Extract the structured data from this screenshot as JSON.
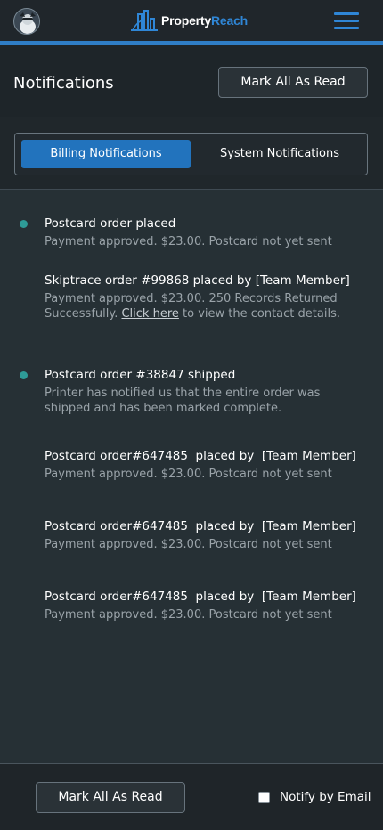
{
  "brand": {
    "name_part1": "Property",
    "name_part2": "Reach",
    "accent": "#2f86d6"
  },
  "header": {
    "title": "Notifications",
    "mark_all_label": "Mark All As Read"
  },
  "tabs": [
    {
      "label": "Billing Notifications",
      "active": true
    },
    {
      "label": "System Notifications",
      "active": false
    }
  ],
  "notifications": [
    {
      "title": "Postcard order placed",
      "desc": "Payment approved. $23.00. Postcard not yet sent",
      "unread": true
    },
    {
      "title": "Skiptrace order #99868 placed by [Team Member]",
      "desc_before": "Payment approved. $23.00. 250 Records Returned Successfully.",
      "link_text": "Click here",
      "desc_after": "to view the contact details.",
      "unread": false
    },
    {
      "title": "Postcard order #38847 shipped",
      "desc": "Printer has notified us that the entire order was shipped and has been marked complete.",
      "unread": true
    },
    {
      "title": "Postcard order#647485  placed by  [Team Member]",
      "desc": "Payment approved. $23.00. Postcard not yet sent",
      "unread": false
    },
    {
      "title": "Postcard order#647485  placed by  [Team Member]",
      "desc": "Payment approved. $23.00. Postcard not yet sent",
      "unread": false
    },
    {
      "title": "Postcard order#647485  placed by  [Team Member]",
      "desc": "Payment approved. $23.00. Postcard not yet sent",
      "unread": false
    }
  ],
  "footer": {
    "mark_all_label": "Mark All As Read",
    "notify_email_label": "Notify by Email",
    "notify_email_checked": false
  },
  "icons": {
    "avatar": "user-avatar-icon",
    "logo": "building-logo-icon",
    "menu": "hamburger-menu-icon",
    "unread": "unread-dot-icon"
  }
}
